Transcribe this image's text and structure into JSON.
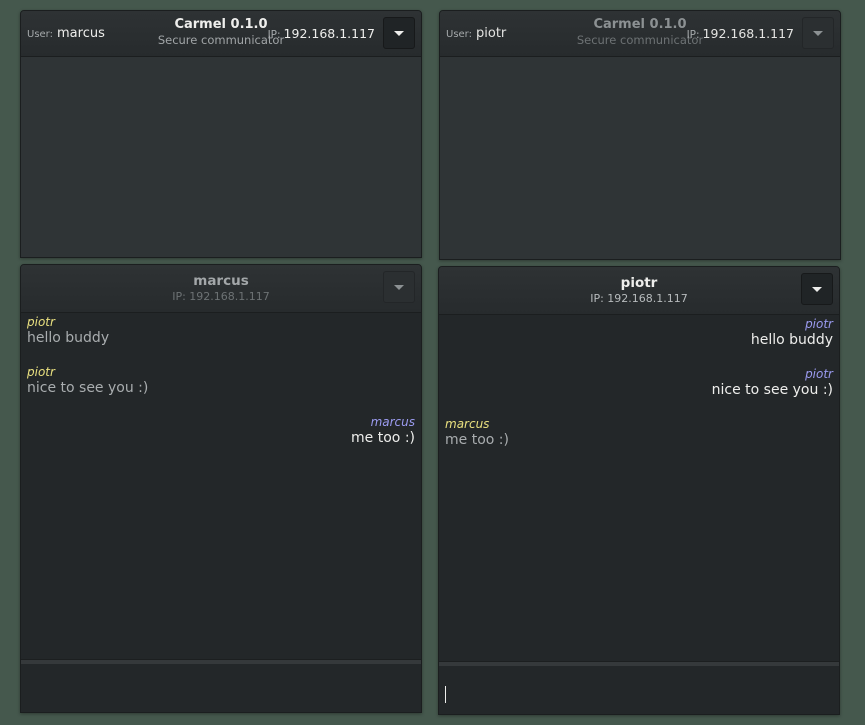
{
  "windows": {
    "main_marcus": {
      "user_label": "User:",
      "user_value": "marcus",
      "title": "Carmel 0.1.0",
      "subtitle": "Secure communicator",
      "ip_label": "IP:",
      "ip_value": "192.168.1.117",
      "menu_icon": "chevron-down-icon"
    },
    "main_piotr": {
      "user_label": "User:",
      "user_value": "piotr",
      "title": "Carmel 0.1.0",
      "subtitle": "Secure communicator",
      "ip_label": "IP:",
      "ip_value": "192.168.1.117",
      "menu_icon": "chevron-down-icon"
    },
    "chat_marcus": {
      "name": "marcus",
      "ip": "IP: 192.168.1.117",
      "messages": [
        {
          "sender": "piotr",
          "text": "hello buddy",
          "direction": "incoming"
        },
        {
          "sender": "piotr",
          "text": "nice to see you :)",
          "direction": "incoming"
        },
        {
          "sender": "marcus",
          "text": "me too :)",
          "direction": "outgoing"
        }
      ],
      "input_value": ""
    },
    "chat_piotr": {
      "name": "piotr",
      "ip": "IP: 192.168.1.117",
      "messages": [
        {
          "sender": "piotr",
          "text": "hello buddy",
          "direction": "outgoing"
        },
        {
          "sender": "piotr",
          "text": "nice to see you :)",
          "direction": "outgoing"
        },
        {
          "sender": "marcus",
          "text": "me too :)",
          "direction": "incoming"
        }
      ],
      "input_value": ""
    }
  },
  "colors": {
    "desktop_background": "#45584d",
    "incoming_sender": "#e9e07f",
    "outgoing_sender": "#9b9bf0",
    "incoming_text": "#a9adaf",
    "outgoing_text": "#eeeeec"
  }
}
